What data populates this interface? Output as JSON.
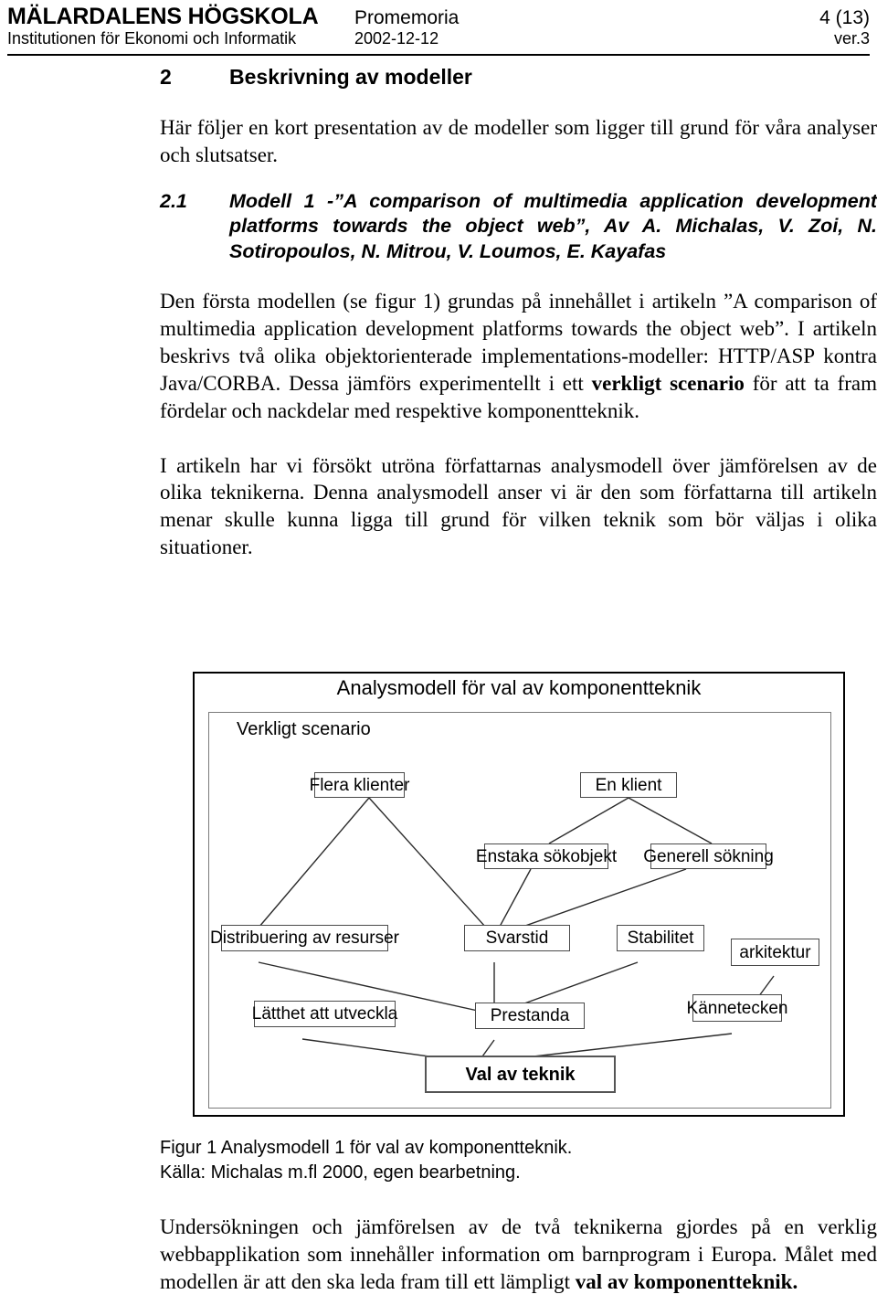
{
  "header": {
    "institution": "MÄLARDALENS HÖGSKOLA",
    "department": "Institutionen för Ekonomi och Informatik",
    "doc_type": "Promemoria",
    "date": "2002-12-12",
    "page": "4 (13)",
    "version": "ver.3"
  },
  "section": {
    "number": "2",
    "title": "Beskrivning av modeller",
    "intro": "Här följer en kort presentation av de modeller som ligger till grund för våra analyser och slutsatser."
  },
  "subsection": {
    "number": "2.1",
    "title": "Modell 1 -”A comparison of multimedia application development platforms towards the object web”, Av A. Michalas, V. Zoi, N. Sotiropoulos, N. Mitrou, V. Loumos, E. Kayafas"
  },
  "paragraphs": {
    "p1_part1": "Den första modellen (se figur 1) grundas på innehållet i artikeln ”A comparison of multimedia application development platforms towards the object web”. I artikeln beskrivs två olika objektorienterade implementations-modeller: HTTP/ASP kontra Java/CORBA. Dessa jämförs experimentellt i ett ",
    "p1_bold": "verkligt scenario",
    "p1_part2": " för att ta fram fördelar och nackdelar med respektive komponentteknik.",
    "p2": "I artikeln har vi försökt utröna författarnas analysmodell över jämförelsen av de olika teknikerna. Denna analysmodell anser vi är den som författarna till artikeln menar skulle kunna ligga till grund för vilken teknik som bör väljas i olika situationer.",
    "p3_part1": "Undersökningen och jämförelsen av de två teknikerna gjordes på en verklig webbapplikation som innehåller information om barnprogram i Europa. Målet med modellen är att den ska leda fram till ett lämpligt ",
    "p3_bold": "val av komponentteknik."
  },
  "figure": {
    "title": "Analysmodell för val av komponentteknik",
    "inner_label": "Verkligt scenario",
    "nodes": {
      "flera_klienter": "Flera klienter",
      "en_klient": "En klient",
      "enstaka_sokobjekt": "Enstaka sökobjekt",
      "generell_sokning": "Generell sökning",
      "distribuering": "Distribuering av resurser",
      "svarstid": "Svarstid",
      "stabilitet": "Stabilitet",
      "arkitektur": "arkitektur",
      "latthet": "Lätthet att utveckla",
      "prestanda": "Prestanda",
      "kannetecken": "Kännetecken",
      "val_av_teknik": "Val av teknik"
    },
    "caption_line1": "Figur 1 Analysmodell 1 för val av komponentteknik.",
    "caption_line2": "Källa: Michalas m.fl 2000, egen bearbetning."
  }
}
